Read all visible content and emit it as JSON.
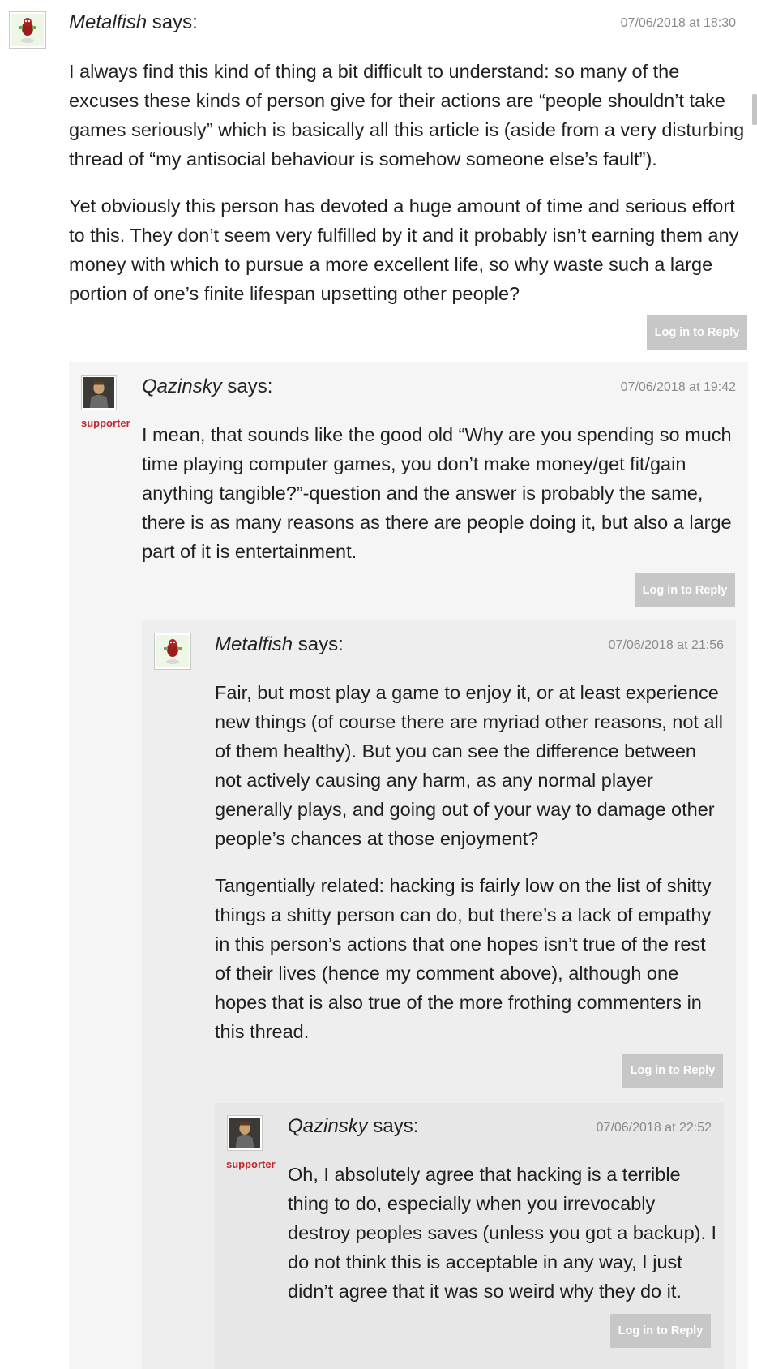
{
  "comments": [
    {
      "author": "Metalfish",
      "says": "says:",
      "date": "07/06/2018 at 18:30",
      "avatar_icon": "metalfish-avatar-icon",
      "paragraphs": [
        "I always find this kind of thing a bit difficult to understand: so many of the excuses these kinds of person give for their actions are “people shouldn’t take games seriously” which is basically all this article is (aside from a very disturbing thread of “my antisocial behaviour is somehow someone else’s fault”).",
        "Yet obviously this person has devoted a huge amount of time and serious effort to this. They don’t seem very fulfilled by it and it probably isn’t earning them any money with which to pursue a more excellent life, so why waste such a large portion of one’s finite lifespan upsetting other people?"
      ],
      "reply_label": "Log in to Reply"
    },
    {
      "author": "Qazinsky",
      "says": "says:",
      "date": "07/06/2018 at 19:42",
      "avatar_icon": "qazinsky-avatar-icon",
      "badge": "supporter",
      "paragraphs": [
        "I mean, that sounds like the good old “Why are you spending so much time playing computer games, you don’t make money/get fit/gain anything tangible?”-question and the answer is probably the same, there is as many reasons as there are people doing it, but also a large part of it is entertainment."
      ],
      "reply_label": "Log in to Reply"
    },
    {
      "author": "Metalfish",
      "says": "says:",
      "date": "07/06/2018 at 21:56",
      "avatar_icon": "metalfish-avatar-icon",
      "paragraphs": [
        "Fair, but most play a game to enjoy it, or at least experience new things (of course there are myriad other reasons, not all of them healthy). But you can see the difference between not actively causing any harm, as any normal player generally plays, and going out of your way to damage other people’s chances at those enjoyment?",
        "Tangentially related: hacking is fairly low on the list of shitty things a shitty person can do, but there’s a lack of empathy in this person’s actions that one hopes isn’t true of the rest of their lives (hence my comment above), although one hopes that is also true of the more frothing commenters in this thread."
      ],
      "reply_label": "Log in to Reply"
    },
    {
      "author": "Qazinsky",
      "says": "says:",
      "date": "07/06/2018 at 22:52",
      "avatar_icon": "qazinsky-avatar-icon",
      "badge": "supporter",
      "paragraphs": [
        "Oh, I absolutely agree that hacking is a terrible thing to do, especially when you irrevocably destroy peoples saves (unless you got a backup). I do not think this is acceptable in any way, I just didn’t agree that it was so weird why they do it."
      ],
      "reply_label": "Log in to Reply"
    }
  ],
  "colors": {
    "panel_level1": "#f5f5f5",
    "panel_level2": "#eeeeee",
    "panel_level3": "#e7e7e7",
    "reply_button": "#c7c7c7",
    "supporter_badge": "#c0262b"
  }
}
